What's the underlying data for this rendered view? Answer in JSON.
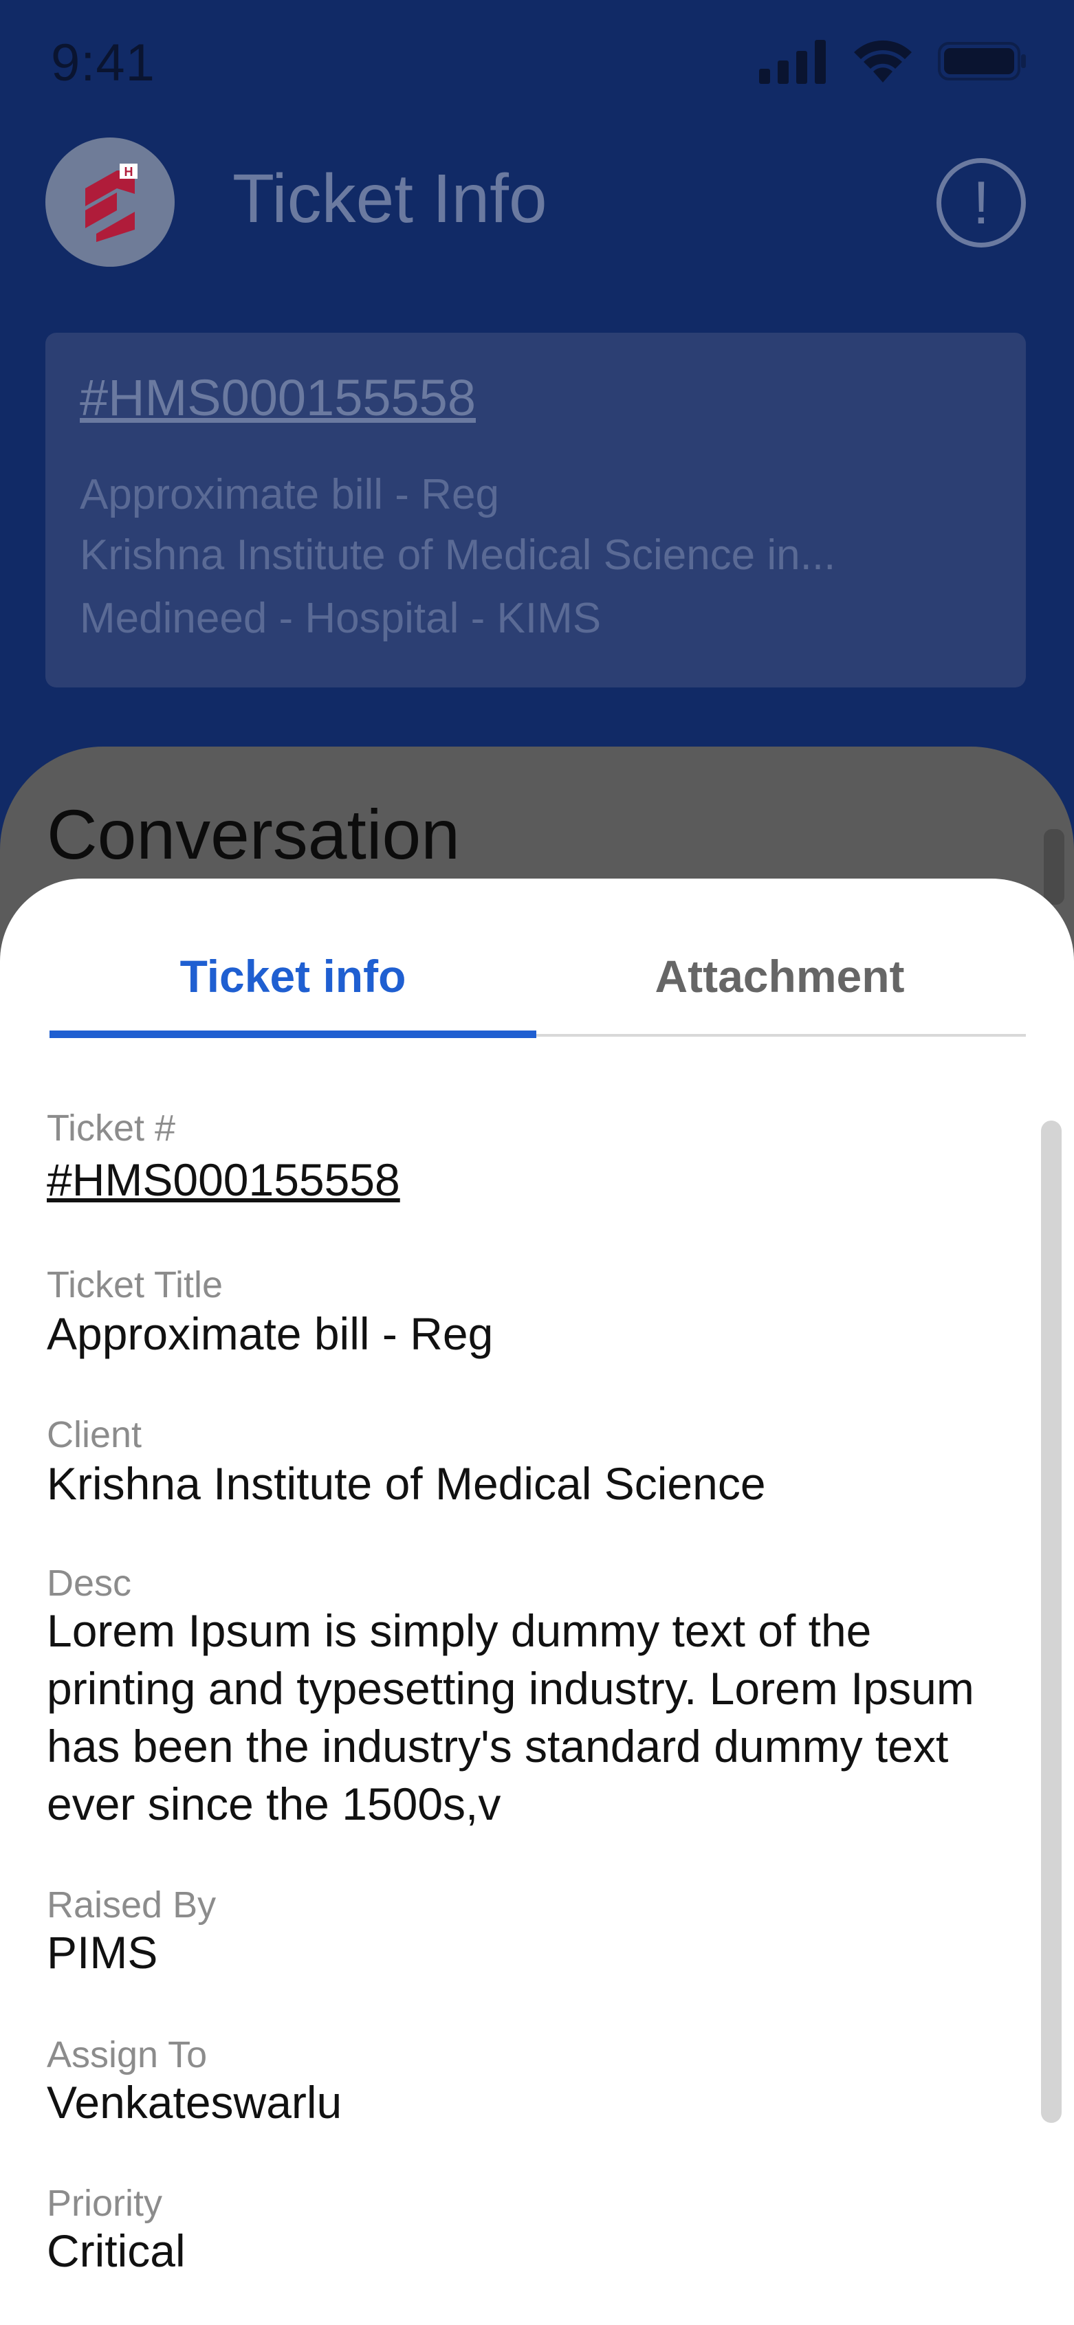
{
  "status_bar": {
    "time": "9:41",
    "icons": [
      "signal-icon",
      "wifi-icon",
      "battery-icon"
    ]
  },
  "header": {
    "title": "Ticket Info",
    "logo_icon": "hospital-logo-icon",
    "info_icon": "info-alert-icon",
    "info_symbol": "!"
  },
  "summary": {
    "ticket_id": "#HMS000155558",
    "lines": [
      "Approximate bill - Reg",
      "Krishna  Institute of Medical Science  in...",
      "Medineed - Hospital - KIMS"
    ]
  },
  "conversation": {
    "title": "Conversation"
  },
  "tabs": [
    {
      "label": "Ticket info",
      "active": true
    },
    {
      "label": "Attachment",
      "active": false
    }
  ],
  "fields": {
    "ticket_no": {
      "label": "Ticket #",
      "value": "#HMS000155558"
    },
    "title": {
      "label": "Ticket Title",
      "value": "Approximate bill - Reg"
    },
    "client": {
      "label": "Client",
      "value": "Krishna  Institute of Medical Science"
    },
    "desc": {
      "label": "Desc",
      "value": "Lorem Ipsum is simply dummy text of the printing and typesetting industry. Lorem Ipsum has been the industry's standard dummy text ever since the 1500s,v"
    },
    "raised_by": {
      "label": "Raised By",
      "value": "PIMS"
    },
    "assign_to": {
      "label": "Assign To",
      "value": "Venkateswarlu"
    },
    "priority": {
      "label": "Priority",
      "value": "Critical"
    }
  },
  "colors": {
    "header_bg": "#112a66",
    "accent": "#1f5fd1",
    "logo_red": "#b01c3a"
  }
}
